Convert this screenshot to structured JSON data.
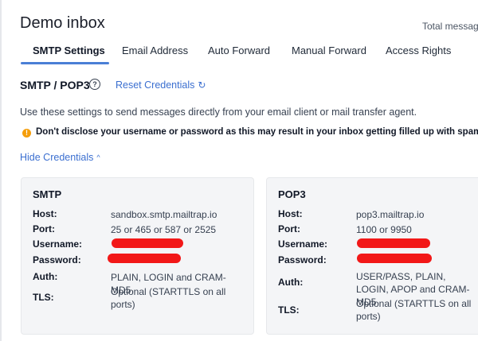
{
  "inbox_title": "Demo inbox",
  "total_messages_label": "Total message",
  "tabs": [
    {
      "label": "SMTP Settings",
      "active": true
    },
    {
      "label": "Email Address",
      "active": false
    },
    {
      "label": "Auto Forward",
      "active": false
    },
    {
      "label": "Manual Forward",
      "active": false
    },
    {
      "label": "Access Rights",
      "active": false
    }
  ],
  "section": {
    "title": "SMTP / POP3",
    "help_glyph": "?",
    "reset_label": "Reset Credentials",
    "reset_icon": "refresh-icon"
  },
  "description": "Use these settings to send messages directly from your email client or mail transfer agent.",
  "warning": {
    "icon": "warning-icon",
    "glyph": "!",
    "text": "Don't disclose your username or password as this may result in your inbox getting filled up with spam."
  },
  "hide_credentials": {
    "label": "Hide Credentials",
    "caret": "^"
  },
  "smtp": {
    "title": "SMTP",
    "host_label": "Host:",
    "host": "sandbox.smtp.mailtrap.io",
    "port_label": "Port:",
    "port": "25 or 465 or 587 or 2525",
    "username_label": "Username:",
    "password_label": "Password:",
    "auth_label": "Auth:",
    "auth": "PLAIN, LOGIN and CRAM-MD5",
    "tls_label": "TLS:",
    "tls": "Optional (STARTTLS on all ports)"
  },
  "pop3": {
    "title": "POP3",
    "host_label": "Host:",
    "host": "pop3.mailtrap.io",
    "port_label": "Port:",
    "port": "1100 or 9950",
    "username_label": "Username:",
    "password_label": "Password:",
    "auth_label": "Auth:",
    "auth": "USER/PASS, PLAIN, LOGIN, APOP and CRAM-MD5",
    "tls_label": "TLS:",
    "tls": "Optional (STARTTLS on all ports)"
  },
  "colors": {
    "accent": "#3b6fd0",
    "warning": "#f59e0b",
    "redaction": "#f21818"
  }
}
